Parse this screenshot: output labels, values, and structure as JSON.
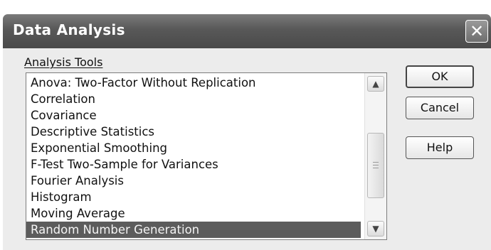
{
  "window": {
    "title": "Data Analysis",
    "close_glyph": "✕"
  },
  "analysis_tools": {
    "label": "Analysis Tools",
    "items": [
      "Anova: Two-Factor Without Replication",
      "Correlation",
      "Covariance",
      "Descriptive Statistics",
      "Exponential Smoothing",
      "F-Test Two-Sample for Variances",
      "Fourier Analysis",
      "Histogram",
      "Moving Average",
      "Random Number Generation"
    ],
    "selected": "Random Number Generation"
  },
  "buttons": {
    "ok": "OK",
    "cancel": "Cancel",
    "help": "Help"
  },
  "icons": {
    "scroll_up": "chevron-up-icon",
    "scroll_down": "chevron-down-icon",
    "close": "close-icon"
  },
  "colors": {
    "titlebar": "#585858",
    "selection": "#5c5c5c"
  }
}
